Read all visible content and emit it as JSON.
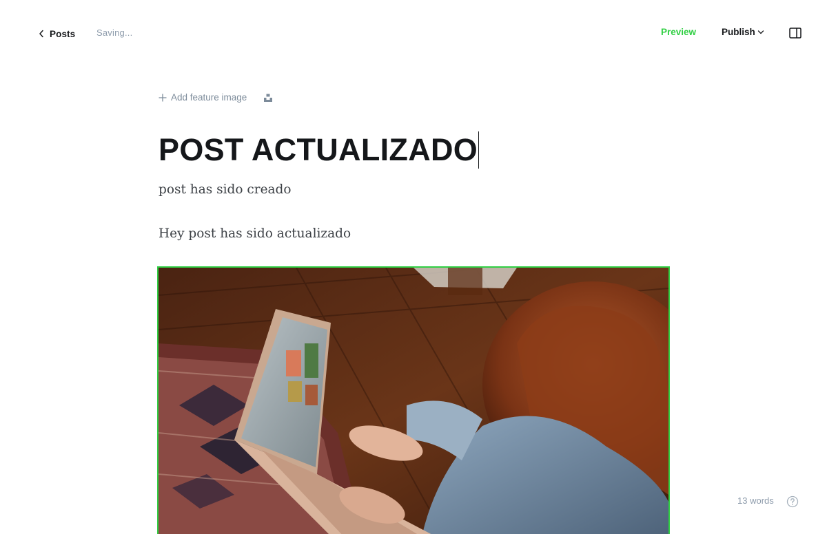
{
  "header": {
    "back_label": "Posts",
    "status": "Saving...",
    "preview_label": "Preview",
    "publish_label": "Publish"
  },
  "editor": {
    "add_feature_image_label": "Add feature image",
    "title": "POST ACTUALIZADO",
    "excerpt": "post has sido creado",
    "paragraph": "Hey post has sido actualizado"
  },
  "footer": {
    "word_count": "13 words"
  },
  "colors": {
    "accent": "#30cf43",
    "text": "#15171a",
    "muted": "#8e9cac"
  },
  "icons": [
    "chevron-left-icon",
    "chevron-down-icon",
    "sidebar-toggle-icon",
    "plus-icon",
    "unsplash-icon",
    "help-icon"
  ]
}
